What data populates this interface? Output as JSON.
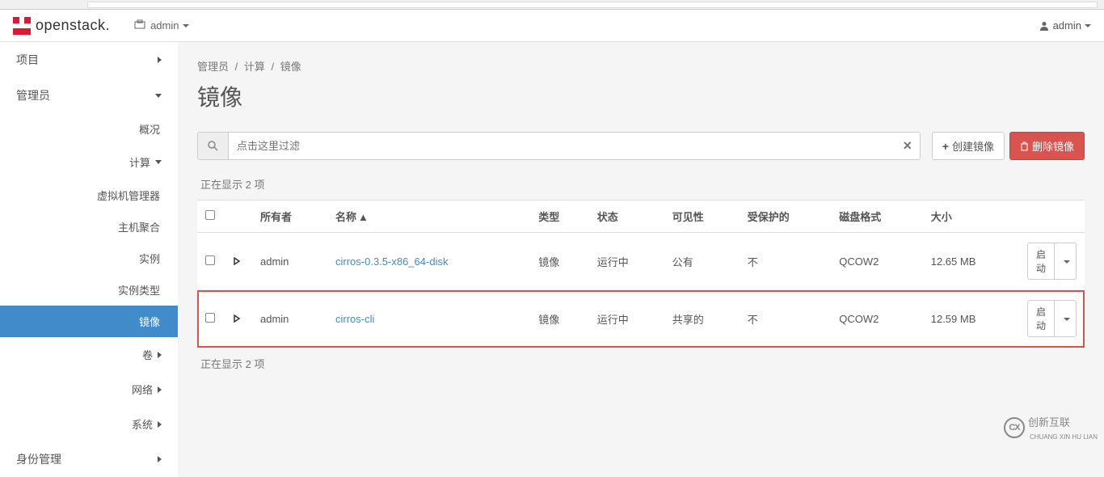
{
  "header": {
    "brand": "openstack",
    "project_label": "admin",
    "user_label": "admin"
  },
  "sidebar": {
    "project": "项目",
    "admin": "管理员",
    "overview": "概况",
    "compute": "计算",
    "hypervisors": "虚拟机管理器",
    "host_aggregates": "主机聚合",
    "instances": "实例",
    "flavors": "实例类型",
    "images": "镜像",
    "volume": "卷",
    "network": "网络",
    "system": "系统",
    "identity": "身份管理"
  },
  "breadcrumb": {
    "a": "管理员",
    "b": "计算",
    "c": "镜像"
  },
  "page_title": "镜像",
  "toolbar": {
    "filter_placeholder": "点击这里过滤",
    "create_image": "创建镜像",
    "delete_image": "删除镜像"
  },
  "table": {
    "showing": "正在显示 2 项",
    "showing_bottom": "正在显示 2 项",
    "cols": {
      "owner": "所有者",
      "name": "名称",
      "type": "类型",
      "status": "状态",
      "visibility": "可见性",
      "protected": "受保护的",
      "disk_format": "磁盘格式",
      "size": "大小"
    },
    "rows": [
      {
        "owner": "admin",
        "name": "cirros-0.3.5-x86_64-disk",
        "type": "镜像",
        "status": "运行中",
        "visibility": "公有",
        "protected": "不",
        "disk_format": "QCOW2",
        "size": "12.65 MB",
        "action": "启动"
      },
      {
        "owner": "admin",
        "name": "cirros-cli",
        "type": "镜像",
        "status": "运行中",
        "visibility": "共享的",
        "protected": "不",
        "disk_format": "QCOW2",
        "size": "12.59 MB",
        "action": "启动"
      }
    ]
  },
  "watermark": {
    "text": "创新互联",
    "sub": "CHUANG XIN HU LIAN"
  }
}
